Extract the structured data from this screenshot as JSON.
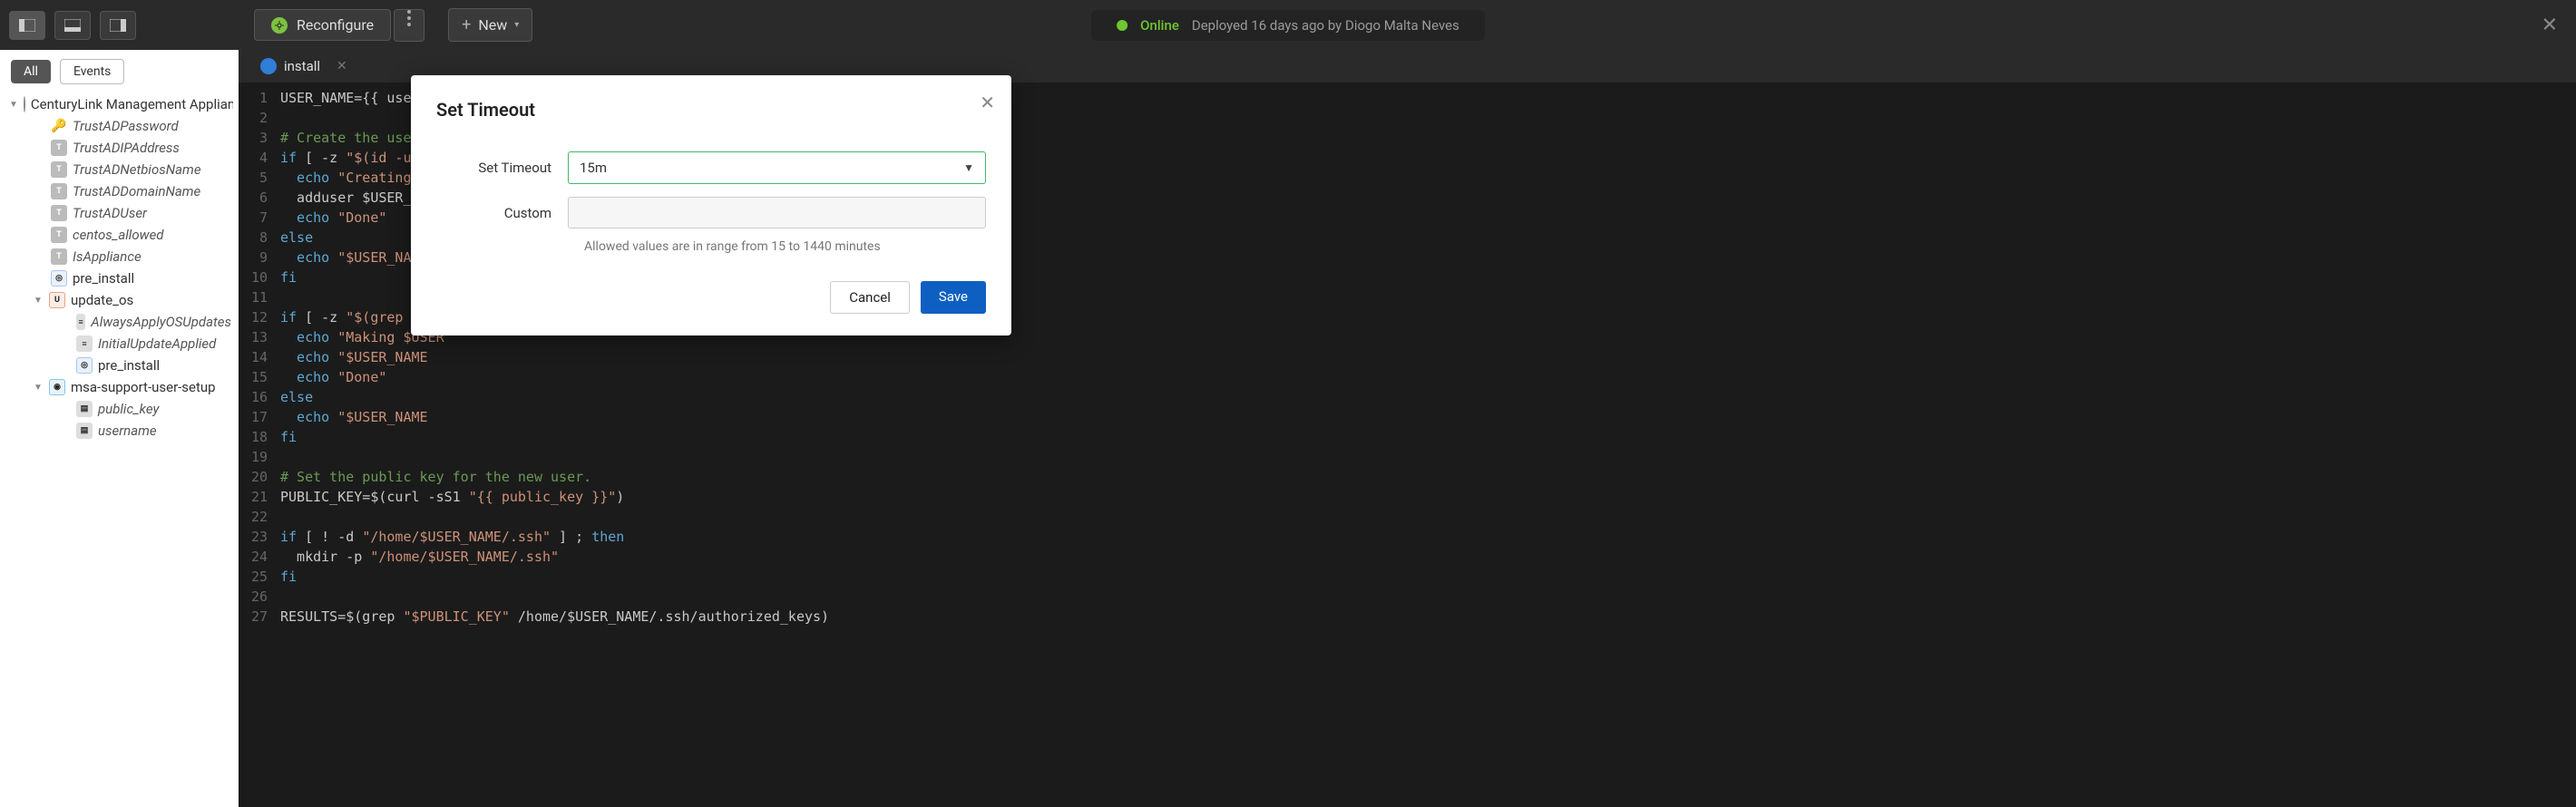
{
  "topbar": {
    "reconfigure_label": "Reconfigure",
    "new_label": "New",
    "status_online": "Online",
    "status_text": "Deployed 16 days ago by Diogo Malta Neves"
  },
  "sidebar": {
    "tab_all": "All",
    "tab_events": "Events",
    "root": "CenturyLink Management Appliance",
    "items1": [
      "TrustADPassword",
      "TrustADIPAddress",
      "TrustADNetbiosName",
      "TrustADDomainName",
      "TrustADUser",
      "centos_allowed",
      "IsAppliance"
    ],
    "pre_install": "pre_install",
    "update_os": "update_os",
    "items2": [
      "AlwaysApplyOSUpdates",
      "InitialUpdateApplied"
    ],
    "pre_install2": "pre_install",
    "msa": "msa-support-user-setup",
    "items3": [
      "public_key",
      "username"
    ]
  },
  "editor": {
    "tab_name": "install",
    "lines": [
      {
        "n": "1",
        "plain": "USER_NAME={{ username }}"
      },
      {
        "n": "2",
        "plain": ""
      },
      {
        "n": "3",
        "comment": "# Create the user, a"
      },
      {
        "n": "4",
        "kw": "if",
        "plain": " [ -z ",
        "str": "\"$(id -u $U"
      },
      {
        "n": "5",
        "kw": "  echo",
        "str": " \"Creating use"
      },
      {
        "n": "6",
        "plain": "  adduser $USER_NAME"
      },
      {
        "n": "7",
        "kw": "  echo",
        "str": " \"Done\""
      },
      {
        "n": "8",
        "kw": "else"
      },
      {
        "n": "9",
        "kw": "  echo",
        "str": " \"$USER_NAME a"
      },
      {
        "n": "10",
        "kw": "fi"
      },
      {
        "n": "11",
        "plain": ""
      },
      {
        "n": "12",
        "kw": "if",
        "plain": " [ -z ",
        "str": "\"$(grep $USE"
      },
      {
        "n": "13",
        "kw": "  echo",
        "str": " \"Making $USER"
      },
      {
        "n": "14",
        "kw": "  echo",
        "str": " \"$USER_NAME "
      },
      {
        "n": "15",
        "kw": "  echo",
        "str": " \"Done\""
      },
      {
        "n": "16",
        "kw": "else"
      },
      {
        "n": "17",
        "kw": "  echo",
        "str": " \"$USER_NAME "
      },
      {
        "n": "18",
        "kw": "fi"
      },
      {
        "n": "19",
        "plain": ""
      },
      {
        "n": "20",
        "comment": "# Set the public key for the new user."
      },
      {
        "n": "21",
        "plain": "PUBLIC_KEY=$(curl -sS1 ",
        "str": "\"{{ public_key }}\"",
        "tail": ")"
      },
      {
        "n": "22",
        "plain": ""
      },
      {
        "n": "23",
        "kw": "if",
        "plain": " [ ! -d ",
        "str": "\"/home/$USER_NAME/.ssh\"",
        "tail": " ] ; ",
        "kw2": "then"
      },
      {
        "n": "24",
        "plain": "  mkdir -p ",
        "str": "\"/home/$USER_NAME/.ssh\""
      },
      {
        "n": "25",
        "kw": "fi"
      },
      {
        "n": "26",
        "plain": ""
      },
      {
        "n": "27",
        "plain": "RESULTS=$(grep ",
        "str": "\"$PUBLIC_KEY\"",
        "tail": " /home/$USER_NAME/.ssh/authorized_keys)"
      }
    ]
  },
  "modal": {
    "title": "Set Timeout",
    "field_timeout": "Set Timeout",
    "timeout_value": "15m",
    "field_custom": "Custom",
    "custom_value": "",
    "hint": "Allowed values are in range from 15 to 1440 minutes",
    "cancel": "Cancel",
    "save": "Save"
  }
}
